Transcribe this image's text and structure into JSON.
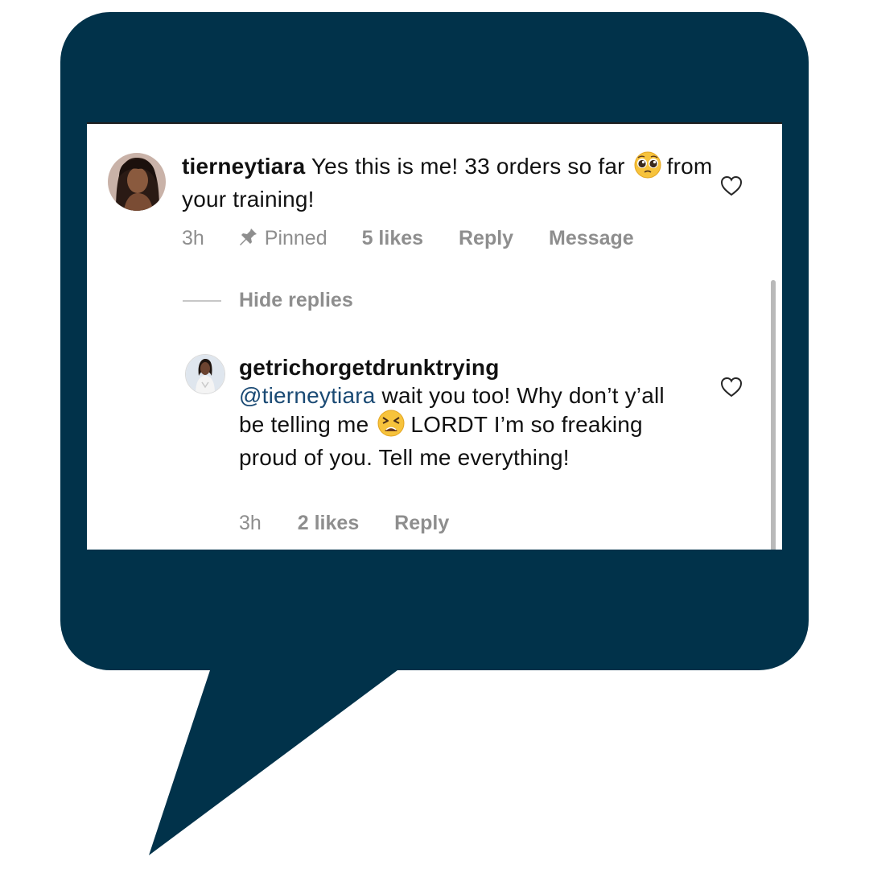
{
  "colors": {
    "bubble": "#01324a",
    "mention": "#1a4a74",
    "meta_text": "#8e8e8e",
    "body_text": "#111111"
  },
  "comment": {
    "username": "tierneytiara",
    "text_before_emoji": "Yes this is me! 33 orders so far",
    "emoji": "pleading-face",
    "text_after_emoji": "from your training!",
    "time": "3h",
    "pinned_label": "Pinned",
    "likes": "5 likes",
    "reply_label": "Reply",
    "message_label": "Message"
  },
  "hide_replies_label": "Hide replies",
  "reply": {
    "username": "getrichorgetdrunktrying",
    "mention": "@tierneytiara",
    "text_before_emoji": "wait you too! Why don’t y’all be telling me",
    "emoji": "tired-face",
    "text_after_emoji": "LORDT I’m so freaking proud of you. Tell me everything!",
    "time": "3h",
    "likes": "2 likes",
    "reply_label": "Reply"
  },
  "icons": {
    "like": "heart-outline-icon",
    "pin": "pin-icon"
  }
}
